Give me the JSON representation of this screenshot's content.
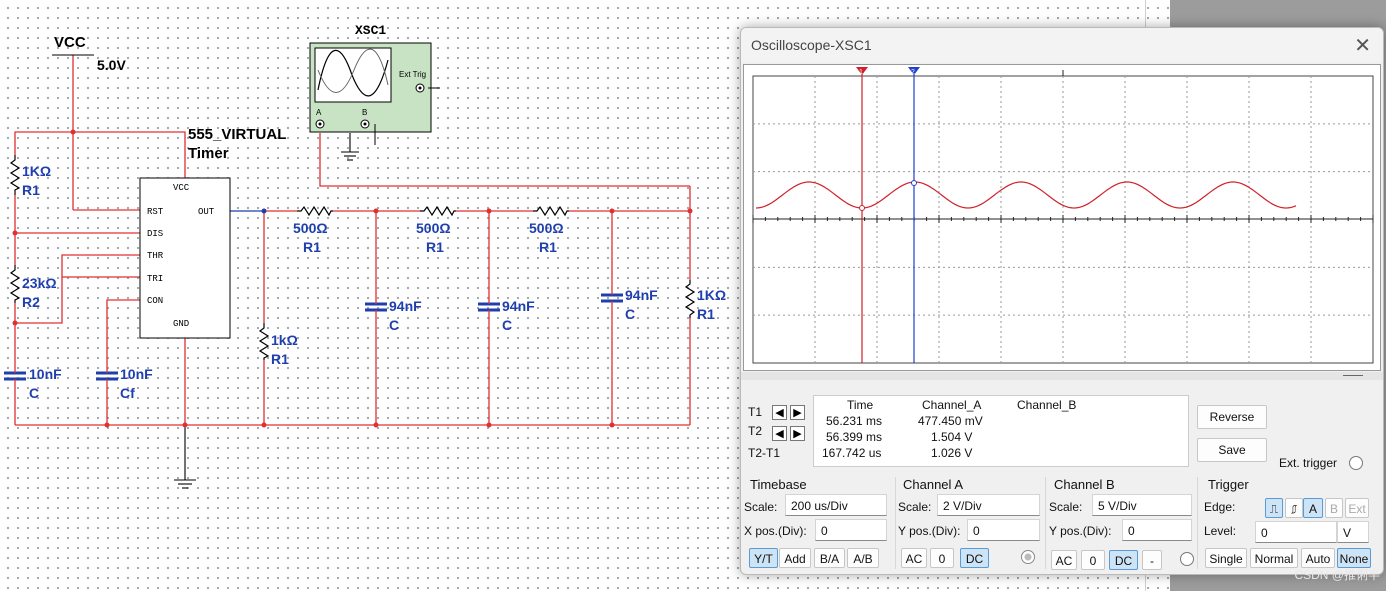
{
  "schematic": {
    "vcc_label": "VCC",
    "vcc_value": "5.0V",
    "scope_name": "XSC1",
    "scope_ext_trig": "Ext Trig",
    "scope_pin_a": "A",
    "scope_pin_b": "B",
    "timer_label_1": "555_VIRTUAL",
    "timer_label_2": "Timer",
    "timer_pins": {
      "vcc": "VCC",
      "rst": "RST",
      "out": "OUT",
      "dis": "DIS",
      "thr": "THR",
      "tri": "TRI",
      "con": "CON",
      "gnd": "GND"
    },
    "parts": [
      {
        "value": "1KΩ",
        "ref": "R1"
      },
      {
        "value": "23kΩ",
        "ref": "R2"
      },
      {
        "value": "10nF",
        "ref": "C"
      },
      {
        "value": "10nF",
        "ref": "Cf"
      },
      {
        "value": "1kΩ",
        "ref": "R1"
      },
      {
        "value": "500Ω",
        "ref": "R1"
      },
      {
        "value": "500Ω",
        "ref": "R1"
      },
      {
        "value": "500Ω",
        "ref": "R1"
      },
      {
        "value": "94nF",
        "ref": "C"
      },
      {
        "value": "94nF",
        "ref": "C"
      },
      {
        "value": "94nF",
        "ref": "C"
      },
      {
        "value": "1KΩ",
        "ref": "R1"
      }
    ]
  },
  "oscilloscope": {
    "title": "Oscilloscope-XSC1",
    "cursor1": "1",
    "cursor2": "2",
    "measure": {
      "headers": [
        "Time",
        "Channel_A",
        "Channel_B"
      ],
      "rows": [
        {
          "label": "T1",
          "time": "56.231 ms",
          "a": "477.450 mV",
          "b": ""
        },
        {
          "label": "T2",
          "time": "56.399 ms",
          "a": "1.504 V",
          "b": ""
        },
        {
          "label": "T2-T1",
          "time": "167.742 us",
          "a": "1.026 V",
          "b": ""
        }
      ]
    },
    "buttons": {
      "reverse": "Reverse",
      "save": "Save",
      "ext_trigger": "Ext. trigger"
    },
    "timebase": {
      "title": "Timebase",
      "scale_label": "Scale:",
      "scale": "200 us/Div",
      "xpos_label": "X pos.(Div):",
      "xpos": "0",
      "modes": [
        "Y/T",
        "Add",
        "B/A",
        "A/B"
      ]
    },
    "channel_a": {
      "title": "Channel A",
      "scale_label": "Scale:",
      "scale": "2  V/Div",
      "ypos_label": "Y pos.(Div):",
      "ypos": "0",
      "coupling": [
        "AC",
        "0",
        "DC"
      ]
    },
    "channel_b": {
      "title": "Channel B",
      "scale_label": "Scale:",
      "scale": "5  V/Div",
      "ypos_label": "Y pos.(Div):",
      "ypos": "0",
      "coupling": [
        "AC",
        "0",
        "DC",
        "-"
      ]
    },
    "trigger": {
      "title": "Trigger",
      "edge_label": "Edge:",
      "edge_src": [
        "A",
        "B",
        "Ext"
      ],
      "level_label": "Level:",
      "level": "0",
      "level_unit": "V",
      "modes": [
        "Single",
        "Normal",
        "Auto",
        "None"
      ]
    },
    "trace_color": "#d0202a"
  },
  "watermark": "CSDN @推俐半"
}
